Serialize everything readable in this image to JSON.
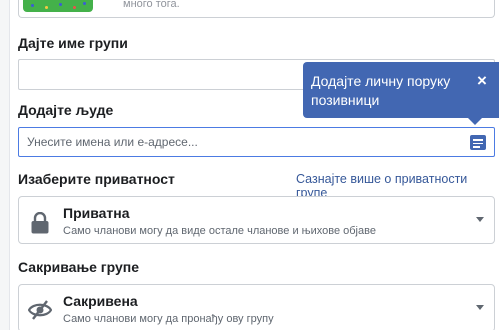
{
  "previous_section": {
    "caption": "много тога."
  },
  "group_name": {
    "label": "Дајте име групи",
    "value": ""
  },
  "add_people": {
    "label": "Додајте људе",
    "placeholder": "Унесите имена или е-адресе..."
  },
  "tooltip": {
    "text": "Додајте личну поруку позивници",
    "close": "×"
  },
  "privacy": {
    "label": "Изаберите приватност",
    "learn_more": "Сазнајте више о приватности групе",
    "selected_title": "Приватна",
    "selected_desc": "Само чланови могу да виде остале чланове и њихове објаве",
    "icon": "lock-icon"
  },
  "hide_group": {
    "label": "Сакривање групе",
    "selected_title": "Сакривена",
    "selected_desc": "Само чланови могу да пронађу ову групу",
    "icon": "eye-slash-icon"
  },
  "colors": {
    "accent": "#4267b2",
    "link": "#365899",
    "border": "#ccd0d5",
    "focus_border": "#4c7be3"
  }
}
